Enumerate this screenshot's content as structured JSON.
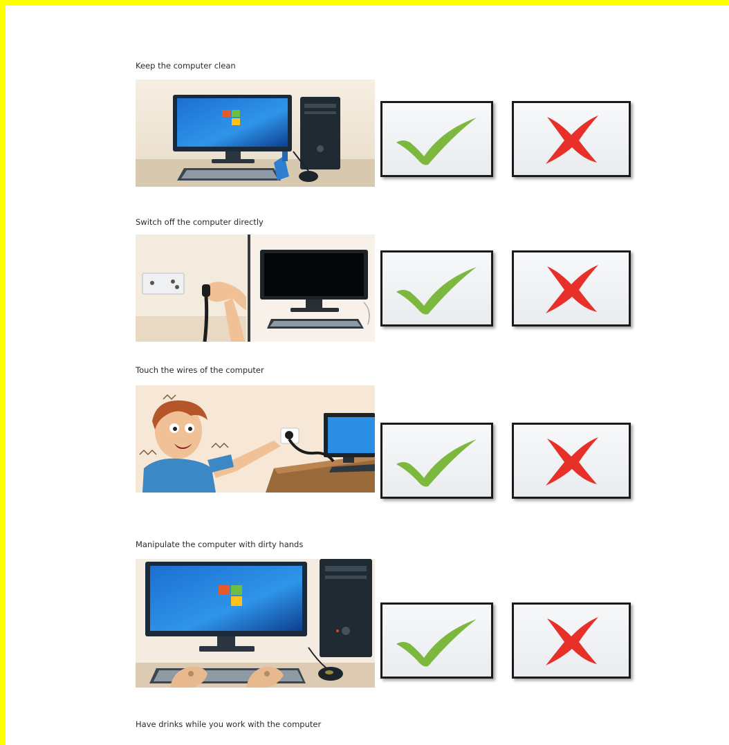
{
  "worksheet": {
    "items": [
      {
        "caption": "Keep the computer clean",
        "image": "computer-cleaning-illustration",
        "choices": [
          "check-icon",
          "cross-icon"
        ]
      },
      {
        "caption": "Switch off the computer directly",
        "image": "unplugging-computer-illustration",
        "choices": [
          "check-icon",
          "cross-icon"
        ]
      },
      {
        "caption": "Touch the wires of the computer",
        "image": "boy-electric-shock-illustration",
        "choices": [
          "check-icon",
          "cross-icon"
        ]
      },
      {
        "caption": "Manipulate the computer with dirty hands",
        "image": "dirty-hands-keyboard-illustration",
        "choices": [
          "check-icon",
          "cross-icon"
        ]
      },
      {
        "caption": "Have drinks while you work with the computer"
      }
    ]
  },
  "colors": {
    "page_border": "#ffff00",
    "check": "#7cb83e",
    "cross": "#e8302a"
  }
}
